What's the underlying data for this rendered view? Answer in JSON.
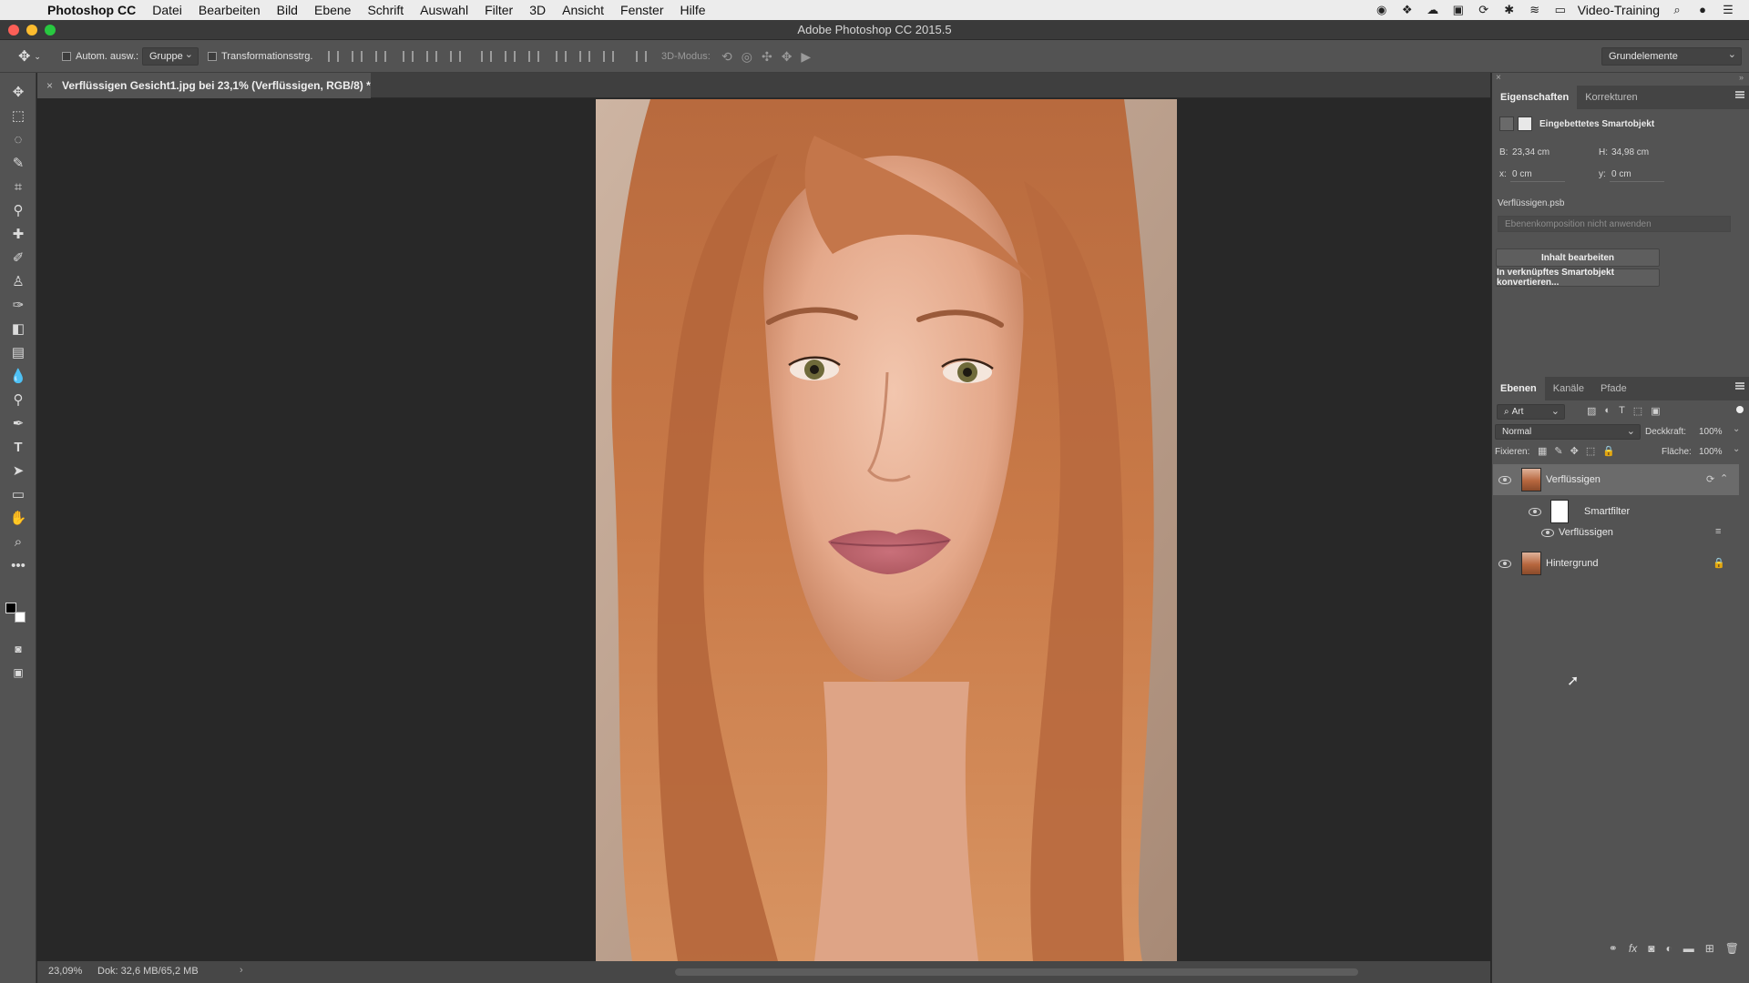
{
  "menubar": {
    "app_name": "Photoshop CC",
    "items": [
      "Datei",
      "Bearbeiten",
      "Bild",
      "Ebene",
      "Schrift",
      "Auswahl",
      "Filter",
      "3D",
      "Ansicht",
      "Fenster",
      "Hilfe"
    ],
    "user": "Video-Training"
  },
  "window": {
    "title": "Adobe Photoshop CC 2015.5"
  },
  "options": {
    "auto_select_label": "Autom. ausw.:",
    "auto_select_value": "Gruppe",
    "transform_label": "Transformationsstrg.",
    "mode3d_label": "3D-Modus:",
    "workspace": "Grundelemente"
  },
  "document": {
    "tab_title": "Verflüssigen Gesicht1.jpg bei 23,1% (Verflüssigen, RGB/8) *",
    "zoom": "23,09%",
    "doc_size": "Dok: 32,6 MB/65,2 MB"
  },
  "properties": {
    "tabs": [
      "Eigenschaften",
      "Korrekturen"
    ],
    "object_type": "Eingebettetes Smartobjekt",
    "w_label": "B:",
    "w_value": "23,34 cm",
    "h_label": "H:",
    "h_value": "34,98 cm",
    "x_label": "x:",
    "x_value": "0 cm",
    "y_label": "y:",
    "y_value": "0 cm",
    "file_name": "Verflüssigen.psb",
    "comp_placeholder": "Ebenenkomposition nicht anwenden",
    "edit_button": "Inhalt bearbeiten",
    "convert_button": "In verknüpftes Smartobjekt konvertieren..."
  },
  "layers": {
    "tabs": [
      "Ebenen",
      "Kanäle",
      "Pfade"
    ],
    "filter_kind": "Art",
    "blend_mode": "Normal",
    "opacity_label": "Deckkraft:",
    "opacity_value": "100%",
    "lock_label": "Fixieren:",
    "fill_label": "Fläche:",
    "fill_value": "100%",
    "items": [
      {
        "name": "Verflüssigen"
      },
      {
        "name": "Smartfilter"
      },
      {
        "name": "Verflüssigen"
      },
      {
        "name": "Hintergrund"
      }
    ]
  },
  "colors": {
    "panel_bg": "#535353",
    "canvas_bg": "#282828",
    "traffic_red": "#fc5f57",
    "traffic_yellow": "#fdbc2e",
    "traffic_green": "#28c840"
  }
}
